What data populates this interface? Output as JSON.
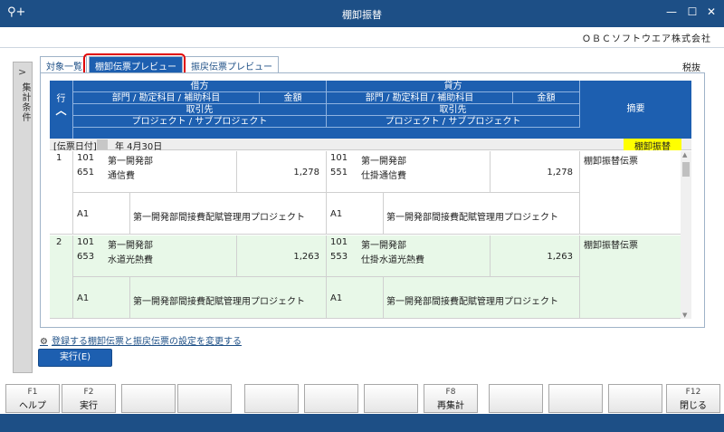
{
  "window": {
    "title": "棚卸振替",
    "app_icon": "⚲+",
    "minimize": "—",
    "maximize": "☐",
    "close": "✕"
  },
  "company": "ＯＢＣソフトウエア株式会社",
  "side_panel": {
    "chevron": ">",
    "label": "集計条件"
  },
  "tabs": [
    {
      "label": "対象一覧"
    },
    {
      "label": "棚卸伝票プレビュー"
    },
    {
      "label": "振戻伝票プレビュー"
    }
  ],
  "zeinuki": "税抜",
  "table_header": {
    "row_label": "行",
    "row_sort_icon": "︿",
    "debit": "借方",
    "credit": "貸方",
    "dept_account": "部門 / 勘定科目 / 補助科目",
    "amount": "金額",
    "partner": "取引先",
    "project": "プロジェクト / サブプロジェクト",
    "summary": "摘要"
  },
  "date_row": {
    "label": "[伝票日付]",
    "value": "年  4月30日",
    "badge": "棚卸振替"
  },
  "records": [
    {
      "no": "1",
      "debit_dept_code": "101",
      "debit_dept_name": "第一開発部",
      "debit_acct_code": "651",
      "debit_acct_name": "通信費",
      "debit_amount": "1,278",
      "credit_dept_code": "101",
      "credit_dept_name": "第一開発部",
      "credit_acct_code": "551",
      "credit_acct_name": "仕掛通信費",
      "credit_amount": "1,278",
      "summary": "棚卸振替伝票",
      "debit_proj_code": "A1",
      "debit_proj_name": "第一開発部間接費配賦管理用プロジェクト",
      "credit_proj_code": "A1",
      "credit_proj_name": "第一開発部間接費配賦管理用プロジェクト"
    },
    {
      "no": "2",
      "debit_dept_code": "101",
      "debit_dept_name": "第一開発部",
      "debit_acct_code": "653",
      "debit_acct_name": "水道光熱費",
      "debit_amount": "1,263",
      "credit_dept_code": "101",
      "credit_dept_name": "第一開発部",
      "credit_acct_code": "553",
      "credit_acct_name": "仕掛水道光熱費",
      "credit_amount": "1,263",
      "summary": "棚卸振替伝票",
      "debit_proj_code": "A1",
      "debit_proj_name": "第一開発部間接費配賦管理用プロジェクト",
      "credit_proj_code": "A1",
      "credit_proj_name": "第一開発部間接費配賦管理用プロジェクト"
    }
  ],
  "settings_link": "登録する棚卸伝票と振戻伝票の設定を変更する",
  "run_button": "実行(E)",
  "fkeys": [
    {
      "key": "F1",
      "name": "ヘルプ"
    },
    {
      "key": "F2",
      "name": "実行"
    },
    {
      "key": "",
      "name": ""
    },
    {
      "key": "",
      "name": ""
    },
    {
      "key": "",
      "name": ""
    },
    {
      "key": "",
      "name": ""
    },
    {
      "key": "",
      "name": ""
    },
    {
      "key": "F8",
      "name": "再集計"
    },
    {
      "key": "",
      "name": ""
    },
    {
      "key": "",
      "name": ""
    },
    {
      "key": "",
      "name": ""
    },
    {
      "key": "F12",
      "name": "閉じる"
    }
  ]
}
